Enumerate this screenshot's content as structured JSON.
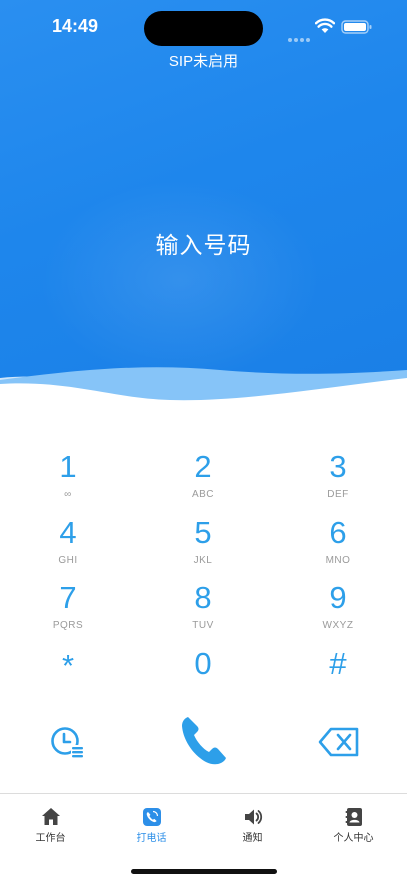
{
  "status_bar": {
    "time": "14:49"
  },
  "header": {
    "sip_status": "SIP未启用",
    "number_display": "输入号码"
  },
  "keypad": {
    "keys": [
      {
        "digit": "1",
        "letters": "∞"
      },
      {
        "digit": "2",
        "letters": "ABC"
      },
      {
        "digit": "3",
        "letters": "DEF"
      },
      {
        "digit": "4",
        "letters": "GHI"
      },
      {
        "digit": "5",
        "letters": "JKL"
      },
      {
        "digit": "6",
        "letters": "MNO"
      },
      {
        "digit": "7",
        "letters": "PQRS"
      },
      {
        "digit": "8",
        "letters": "TUV"
      },
      {
        "digit": "9",
        "letters": "WXYZ"
      },
      {
        "digit": "*",
        "letters": ""
      },
      {
        "digit": "0",
        "letters": ""
      },
      {
        "digit": "#",
        "letters": ""
      }
    ]
  },
  "actions": {
    "history_icon": "call-history-icon",
    "call_icon": "phone-icon",
    "delete_icon": "backspace-icon"
  },
  "tab_bar": {
    "active_tab": "打电话",
    "tabs": [
      {
        "label": "工作台",
        "icon": "home-icon"
      },
      {
        "label": "打电话",
        "icon": "phone-app-icon"
      },
      {
        "label": "通知",
        "icon": "speaker-icon"
      },
      {
        "label": "个人中心",
        "icon": "contact-book-icon"
      }
    ]
  },
  "colors": {
    "header_blue": "#1e86ec",
    "accent": "#2d9fe9",
    "tab_active": "#2d8fe8"
  }
}
